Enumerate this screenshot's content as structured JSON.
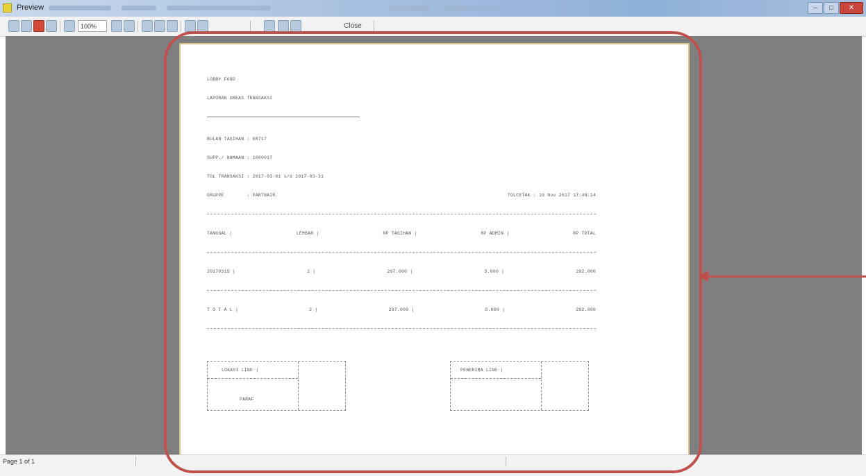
{
  "window": {
    "title": "Preview",
    "controls": {
      "minimize": "–",
      "maximize": "□",
      "close": "✕"
    }
  },
  "toolbar": {
    "zoom": "100%",
    "close_label": "Close"
  },
  "report": {
    "company": "LOBBY FOOD",
    "report_title": "LAPORAN UBEAS TRANSAKSI",
    "underline": "==================================",
    "meta": [
      "BULAN TAGIHAN : 08717",
      "SUPP./ NAMAAN : 1000017",
      "TGL TRANSAKSI : 2017-03-01 s/d 2017-03-31",
      "GRUPPE        : PARTNAIR"
    ],
    "printed": "TGLCETAK : 10 Nov 2017 17:48:14",
    "columns": [
      "TANGGAL |",
      "LEMBAR |",
      "RP TAGIHAN |",
      "RP ADMIN |",
      "RP TOTAL"
    ],
    "rows": [
      [
        "20170315 |",
        "2 |",
        "297.000 |",
        "5.000 |",
        "292.000"
      ]
    ],
    "total": [
      "T O T A L |",
      "2 |",
      "297.000 |",
      "5.000 |",
      "292.000"
    ],
    "sign_left_label": "LOKASI LINE |",
    "sign_left_sub": "PARAF",
    "sign_right_label": "PENERIMA LINE |"
  },
  "status": {
    "page": "Page 1 of 1"
  },
  "annotation": {
    "color": "#c0504d"
  }
}
